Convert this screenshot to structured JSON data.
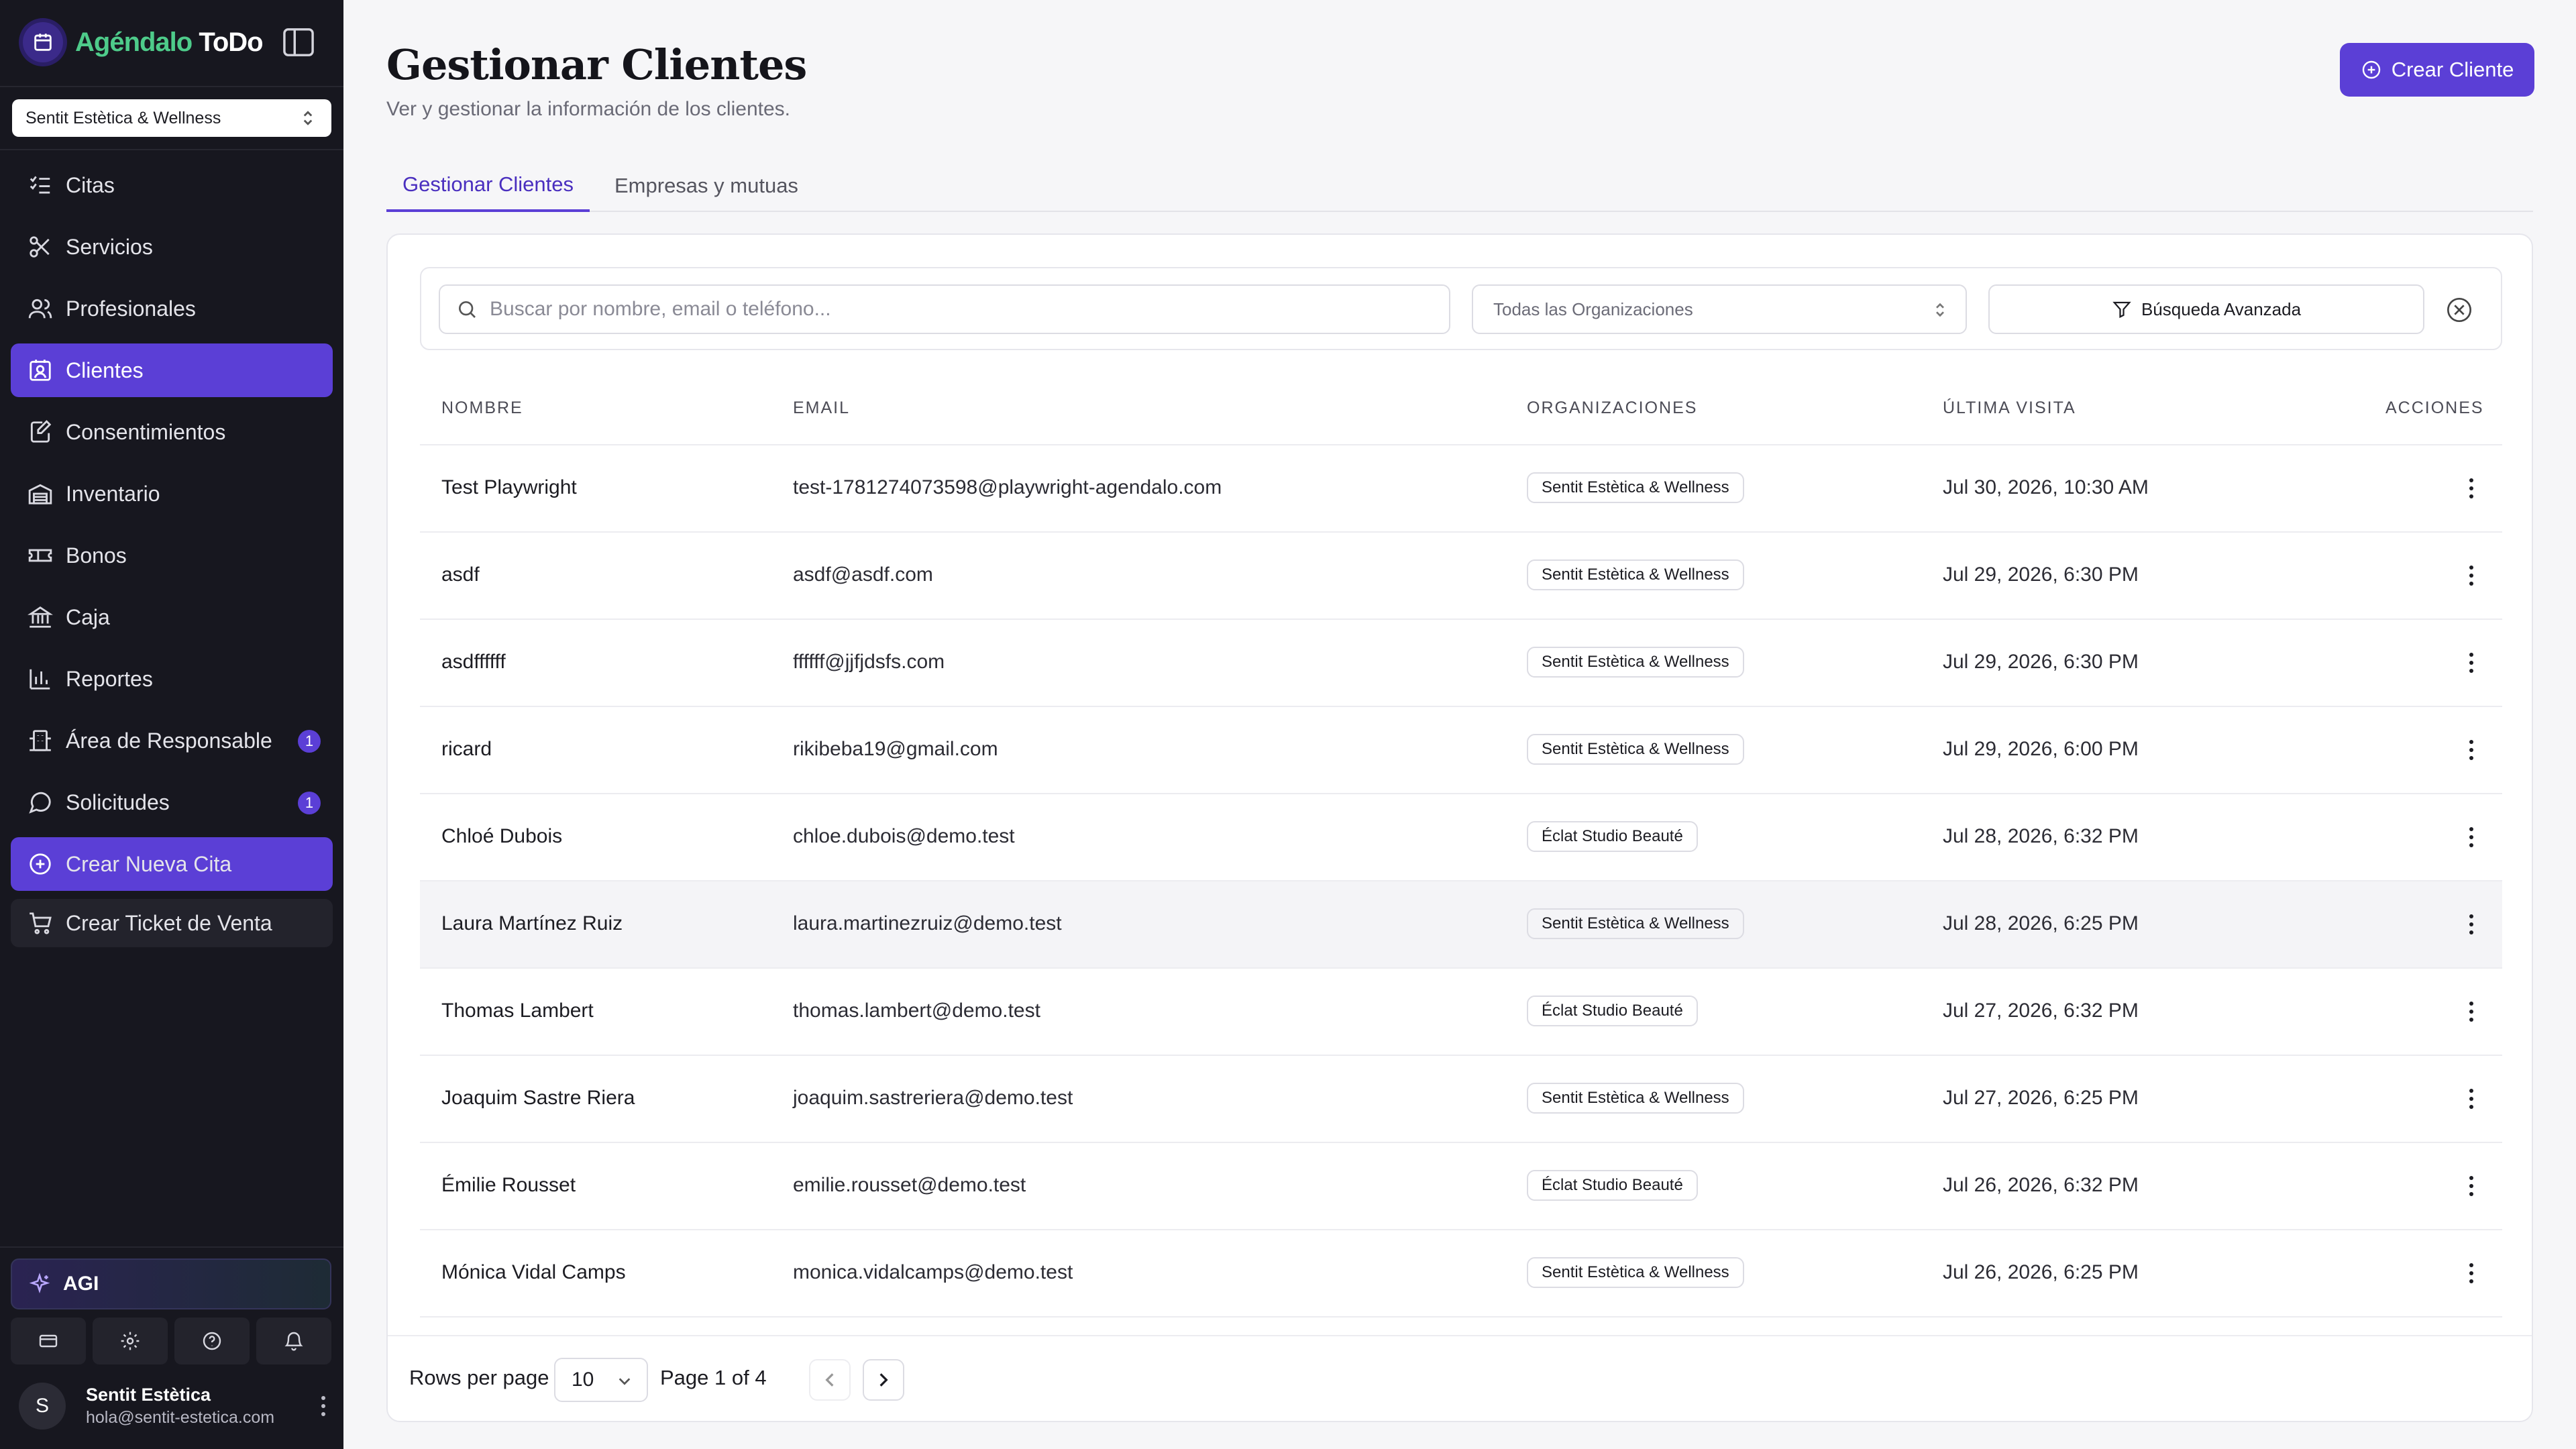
{
  "app": {
    "brand_part1": "Agéndalo",
    "brand_part2": "ToDo",
    "org_selected": "Sentit Estètica & Wellness"
  },
  "sidebar": {
    "items": [
      {
        "label": "Citas",
        "icon": "checklist-icon"
      },
      {
        "label": "Servicios",
        "icon": "scissors-icon"
      },
      {
        "label": "Profesionales",
        "icon": "users-icon"
      },
      {
        "label": "Clientes",
        "icon": "contact-card-icon",
        "active": true
      },
      {
        "label": "Consentimientos",
        "icon": "signature-document-icon"
      },
      {
        "label": "Inventario",
        "icon": "warehouse-icon"
      },
      {
        "label": "Bonos",
        "icon": "ticket-icon"
      },
      {
        "label": "Caja",
        "icon": "bank-icon"
      },
      {
        "label": "Reportes",
        "icon": "bar-chart-icon"
      },
      {
        "label": "Área de Responsable",
        "icon": "building-icon",
        "badge": "1"
      },
      {
        "label": "Solicitudes",
        "icon": "message-icon",
        "badge": "1"
      }
    ],
    "cta_new_appointment": "Crear Nueva Cita",
    "cta_sale_ticket": "Crear Ticket de Venta",
    "agi_label": "AGI",
    "user": {
      "initial": "S",
      "name": "Sentit Estètica",
      "email": "hola@sentit-estetica.com"
    }
  },
  "header": {
    "title": "Gestionar Clientes",
    "subtitle": "Ver y gestionar la información de los clientes.",
    "create_button": "Crear Cliente"
  },
  "tabs": [
    {
      "label": "Gestionar Clientes",
      "active": true
    },
    {
      "label": "Empresas y mutuas",
      "active": false
    }
  ],
  "filters": {
    "search_placeholder": "Buscar por nombre, email o teléfono...",
    "org_filter": "Todas las Organizaciones",
    "advanced_search": "Búsqueda Avanzada"
  },
  "table": {
    "columns": [
      "NOMBRE",
      "EMAIL",
      "ORGANIZACIONES",
      "ÚLTIMA VISITA",
      "ACCIONES"
    ],
    "rows": [
      {
        "name": "Test Playwright",
        "email": "test-1781274073598@playwright-agendalo.com",
        "org": "Sentit Estètica & Wellness",
        "last_visit": "Jul 30, 2026, 10:30 AM"
      },
      {
        "name": "asdf",
        "email": "asdf@asdf.com",
        "org": "Sentit Estètica & Wellness",
        "last_visit": "Jul 29, 2026, 6:30 PM"
      },
      {
        "name": "asdffffff",
        "email": "ffffff@jjfjdsfs.com",
        "org": "Sentit Estètica & Wellness",
        "last_visit": "Jul 29, 2026, 6:30 PM"
      },
      {
        "name": "ricard",
        "email": "rikibeba19@gmail.com",
        "org": "Sentit Estètica & Wellness",
        "last_visit": "Jul 29, 2026, 6:00 PM"
      },
      {
        "name": "Chloé Dubois",
        "email": "chloe.dubois@demo.test",
        "org": "Éclat Studio Beauté",
        "last_visit": "Jul 28, 2026, 6:32 PM"
      },
      {
        "name": "Laura Martínez Ruiz",
        "email": "laura.martinezruiz@demo.test",
        "org": "Sentit Estètica & Wellness",
        "last_visit": "Jul 28, 2026, 6:25 PM"
      },
      {
        "name": "Thomas Lambert",
        "email": "thomas.lambert@demo.test",
        "org": "Éclat Studio Beauté",
        "last_visit": "Jul 27, 2026, 6:32 PM"
      },
      {
        "name": "Joaquim Sastre Riera",
        "email": "joaquim.sastreriera@demo.test",
        "org": "Sentit Estètica & Wellness",
        "last_visit": "Jul 27, 2026, 6:25 PM"
      },
      {
        "name": "Émilie Rousset",
        "email": "emilie.rousset@demo.test",
        "org": "Éclat Studio Beauté",
        "last_visit": "Jul 26, 2026, 6:32 PM"
      },
      {
        "name": "Mónica Vidal Camps",
        "email": "monica.vidalcamps@demo.test",
        "org": "Sentit Estètica & Wellness",
        "last_visit": "Jul 26, 2026, 6:25 PM"
      }
    ]
  },
  "pagination": {
    "rows_per_page_label": "Rows per page",
    "rows_per_page": "10",
    "page_info": "Page 1 of 4"
  },
  "colors": {
    "accent": "#5b3fd6",
    "sidebar_bg": "#17171f",
    "brand_green": "#4ecb8a"
  }
}
